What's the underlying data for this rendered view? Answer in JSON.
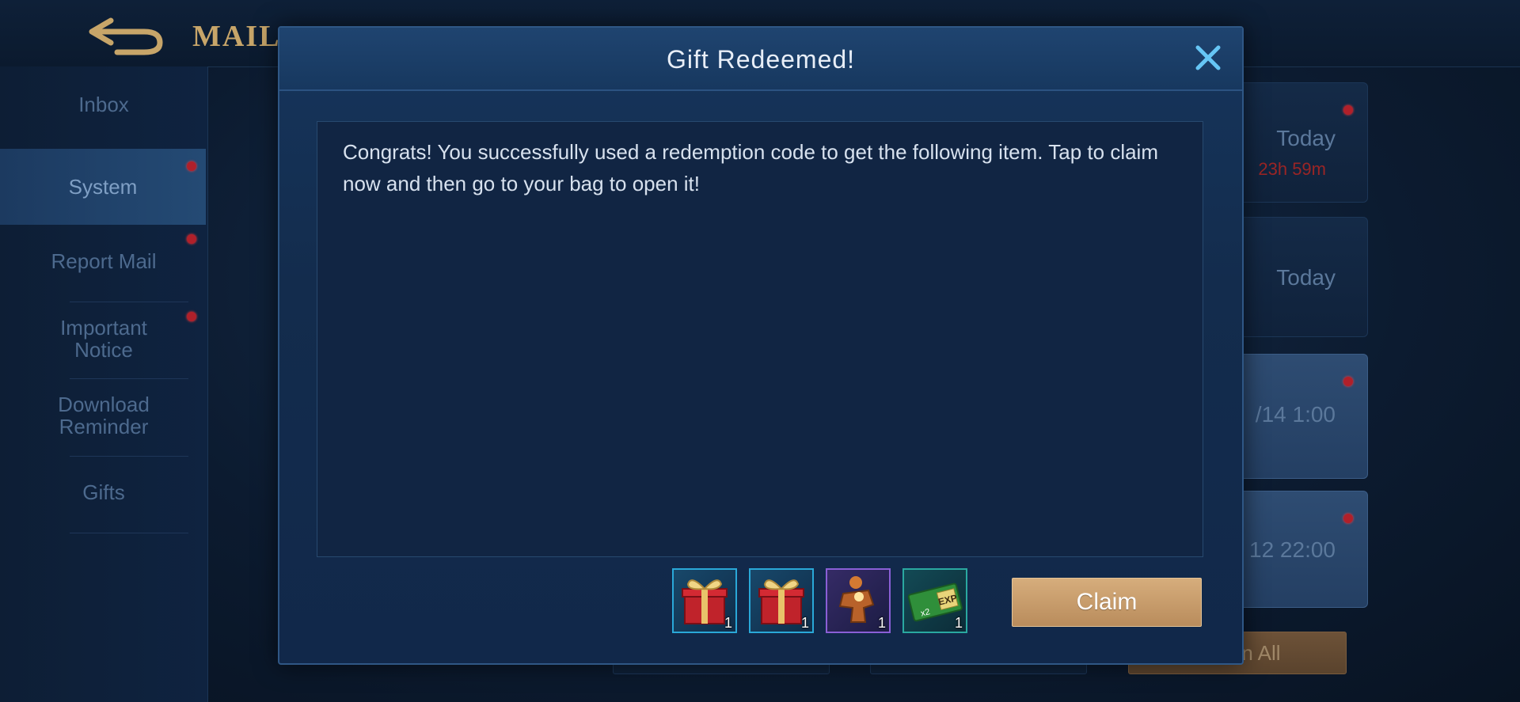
{
  "header": {
    "title": "MAIL"
  },
  "sidebar": {
    "items": [
      {
        "label": "Inbox"
      },
      {
        "label": "System"
      },
      {
        "label": "Report Mail"
      },
      {
        "label": "Important Notice"
      },
      {
        "label": "Download Reminder"
      },
      {
        "label": "Gifts"
      }
    ]
  },
  "mail_list": {
    "cards": [
      {
        "date": "Today",
        "timer": "23h 59m"
      },
      {
        "date": "Today"
      },
      {
        "date": "/14 1:00"
      },
      {
        "date": "12 22:00"
      }
    ],
    "claim_all_label": "n All"
  },
  "modal": {
    "title": "Gift Redeemed!",
    "message": "Congrats! You successfully used a redemption code to get the following item. Tap to claim now and then go to your bag to open it!",
    "items": [
      {
        "icon": "gift-box-icon",
        "quantity": "1"
      },
      {
        "icon": "gift-box-icon",
        "quantity": "1"
      },
      {
        "icon": "hero-fragment-icon",
        "quantity": "1"
      },
      {
        "icon": "double-exp-card-icon",
        "quantity": "1",
        "badge": "x2",
        "label": "EXP"
      }
    ],
    "claim_label": "Claim"
  },
  "colors": {
    "accent_gold": "#c7a569",
    "claim_button": "#c99d6c",
    "notification_dot": "#b0202a"
  }
}
